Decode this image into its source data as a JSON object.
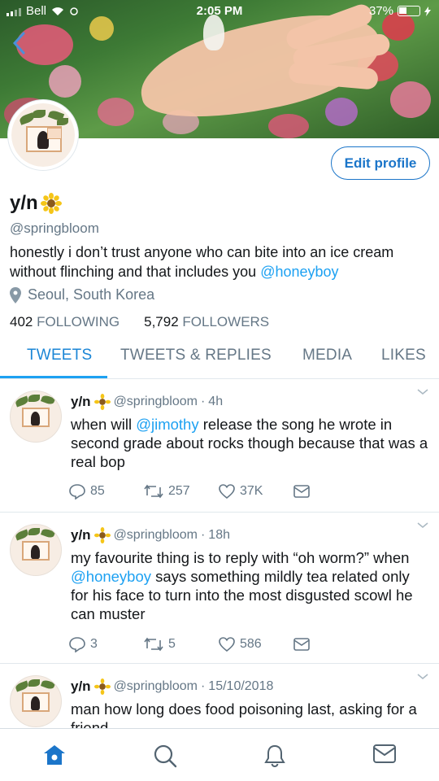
{
  "status_bar": {
    "carrier": "Bell",
    "time": "2:05 PM",
    "battery": "37%"
  },
  "colors": {
    "accent": "#1da1f2",
    "link": "#1da1f2",
    "secondary_text": "#657786",
    "primary_text": "#14171a"
  },
  "profile": {
    "name": "y/n",
    "handle": "@springbloom",
    "bio_text": "honestly i don’t trust anyone who can bite into an ice cream without flinching and that includes you ",
    "bio_link": "@honeyboy",
    "location": "Seoul, South Korea",
    "edit_label": "Edit profile",
    "following_count": "402",
    "following_label": "FOLLOWING",
    "followers_count": "5,792",
    "followers_label": "FOLLOWERS"
  },
  "tabs": [
    {
      "label": "TWEETS",
      "active": true
    },
    {
      "label": "TWEETS & REPLIES",
      "active": false
    },
    {
      "label": "MEDIA",
      "active": false
    },
    {
      "label": "LIKES",
      "active": false
    }
  ],
  "tweets": [
    {
      "name": "y/n",
      "handle": "@springbloom",
      "time": "4h",
      "text_before": "when will ",
      "mention": "@jimothy",
      "text_after": " release the song he wrote in second grade about rocks though because that was a real bop",
      "replies": "85",
      "retweets": "257",
      "likes": "37K"
    },
    {
      "name": "y/n",
      "handle": "@springbloom",
      "time": "18h",
      "text_before": "my favourite thing is to reply with “oh worm?” when ",
      "mention": "@honeyboy",
      "text_after": " says something mildly tea related only for his face to turn into the most disgusted scowl he can muster",
      "replies": "3",
      "retweets": "5",
      "likes": "586"
    },
    {
      "name": "y/n",
      "handle": "@springbloom",
      "time": "15/10/2018",
      "text_before": "man how long does food poisoning last, asking for a friend",
      "mention": "",
      "text_after": ""
    }
  ],
  "icons": {
    "emoji": "sunflower",
    "nav": [
      "home-icon",
      "search-icon",
      "notifications-icon",
      "messages-icon"
    ]
  }
}
